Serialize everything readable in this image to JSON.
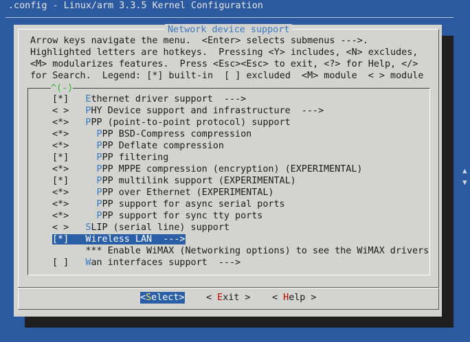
{
  "window": {
    "title": ".config - Linux/arm 3.3.5 Kernel Configuration"
  },
  "dialog": {
    "title": "Network device support",
    "help_lines": [
      "Arrow keys navigate the menu.  <Enter> selects submenus --->.",
      "Highlighted letters are hotkeys.  Pressing <Y> includes, <N> excludes,",
      "<M> modularizes features.  Press <Esc><Esc> to exit, <?> for Help, </>",
      "for Search.  Legend: [*] built-in  [ ] excluded  <M> module  < > module"
    ],
    "scroll_indicator": "^(-)"
  },
  "menu": {
    "items": [
      {
        "mark": "[*]",
        "indent": "",
        "hotkey": "E",
        "rest": "thernet driver support  --->"
      },
      {
        "mark": "< >",
        "indent": "",
        "hotkey": "P",
        "rest": "HY Device support and infrastructure  --->"
      },
      {
        "mark": "<*>",
        "indent": "",
        "hotkey": "P",
        "rest": "PP (point-to-point protocol) support"
      },
      {
        "mark": "<*>",
        "indent": "  ",
        "hotkey": "P",
        "rest": "PP BSD-Compress compression"
      },
      {
        "mark": "<*>",
        "indent": "  ",
        "hotkey": "P",
        "rest": "PP Deflate compression"
      },
      {
        "mark": "[*]",
        "indent": "  ",
        "hotkey": "P",
        "rest": "PP filtering"
      },
      {
        "mark": "<*>",
        "indent": "  ",
        "hotkey": "P",
        "rest": "PP MPPE compression (encryption) (EXPERIMENTAL)"
      },
      {
        "mark": "[*]",
        "indent": "  ",
        "hotkey": "P",
        "rest": "PP multilink support (EXPERIMENTAL)"
      },
      {
        "mark": "<*>",
        "indent": "  ",
        "hotkey": "P",
        "rest": "PP over Ethernet (EXPERIMENTAL)"
      },
      {
        "mark": "<*>",
        "indent": "  ",
        "hotkey": "P",
        "rest": "PP support for async serial ports"
      },
      {
        "mark": "<*>",
        "indent": "  ",
        "hotkey": "P",
        "rest": "PP support for sync tty ports"
      },
      {
        "mark": "< >",
        "indent": "",
        "hotkey": "S",
        "rest": "LIP (serial line) support"
      },
      {
        "mark": "[*]",
        "indent": "",
        "hotkey": "W",
        "rest": "ireless LAN  --->",
        "selected": true
      },
      {
        "mark": "",
        "indent": "",
        "hotkey": "",
        "rest": "*** Enable WiMAX (Networking options) to see the WiMAX drivers"
      },
      {
        "mark": "[ ]",
        "indent": "",
        "hotkey": "W",
        "rest": "an interfaces support  --->"
      }
    ]
  },
  "buttons": {
    "select": {
      "pre": "<",
      "hotkey": "S",
      "rest": "elect>"
    },
    "exit": {
      "pre": "< ",
      "hotkey": "E",
      "rest": "xit >"
    },
    "help": {
      "pre": "< ",
      "hotkey": "H",
      "rest": "elp >"
    }
  },
  "colors": {
    "background": "#2c5aa0",
    "dialog": "#d3d3cf",
    "highlight": "#2a5fa8",
    "hotkey": "#3a79c0",
    "hotkey_selected": "#f0e060",
    "button_hotkey": "#c00000"
  }
}
